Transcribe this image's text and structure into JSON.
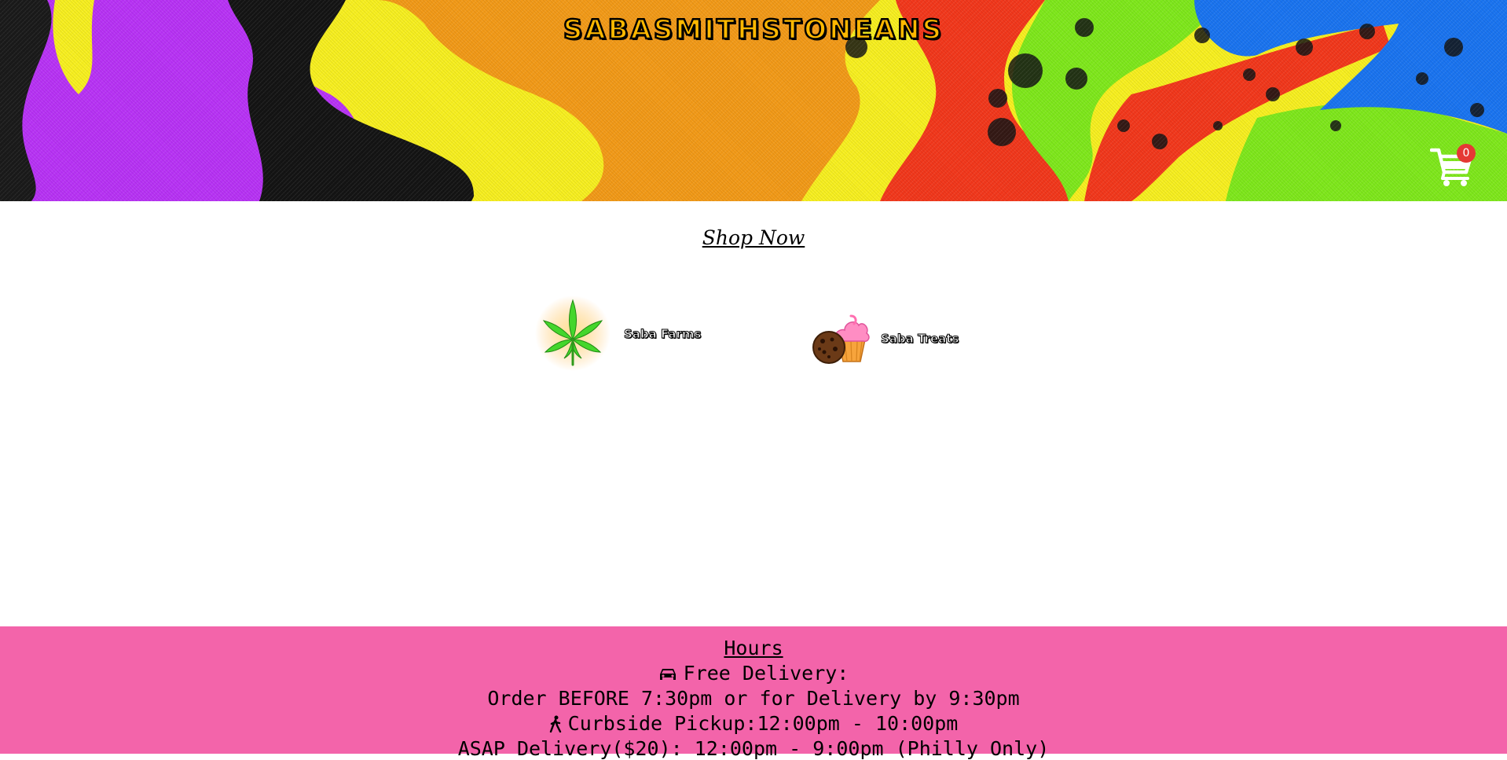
{
  "header": {
    "site_title": "SABASMITHSTONEANS",
    "cart_count": "0"
  },
  "main": {
    "shop_now_label": "Shop Now",
    "categories": [
      {
        "label": "Saba Farms",
        "icon": "cannabis-leaf-icon"
      },
      {
        "label": "Saba Treats",
        "icon": "cupcake-cookie-icon"
      }
    ]
  },
  "footer": {
    "hours_title": "Hours",
    "free_delivery_label": "Free Delivery:",
    "order_before_text": "Order BEFORE 7:30pm or for Delivery by 9:30pm",
    "curbside_text": "Curbside Pickup:12:00pm - 10:00pm",
    "asap_text": "ASAP Delivery($20): 12:00pm - 9:00pm (Philly Only)",
    "icons": [
      "car-icon",
      "walking-person-icon"
    ]
  },
  "colors": {
    "footer_bg": "#f364aa",
    "badge": "#e53935",
    "banner_purple": "#b833f5",
    "banner_yellow": "#f7ef20",
    "banner_orange": "#f29a18",
    "banner_red": "#f2381c",
    "banner_green": "#7fe81c",
    "banner_blue": "#1a74f0"
  }
}
